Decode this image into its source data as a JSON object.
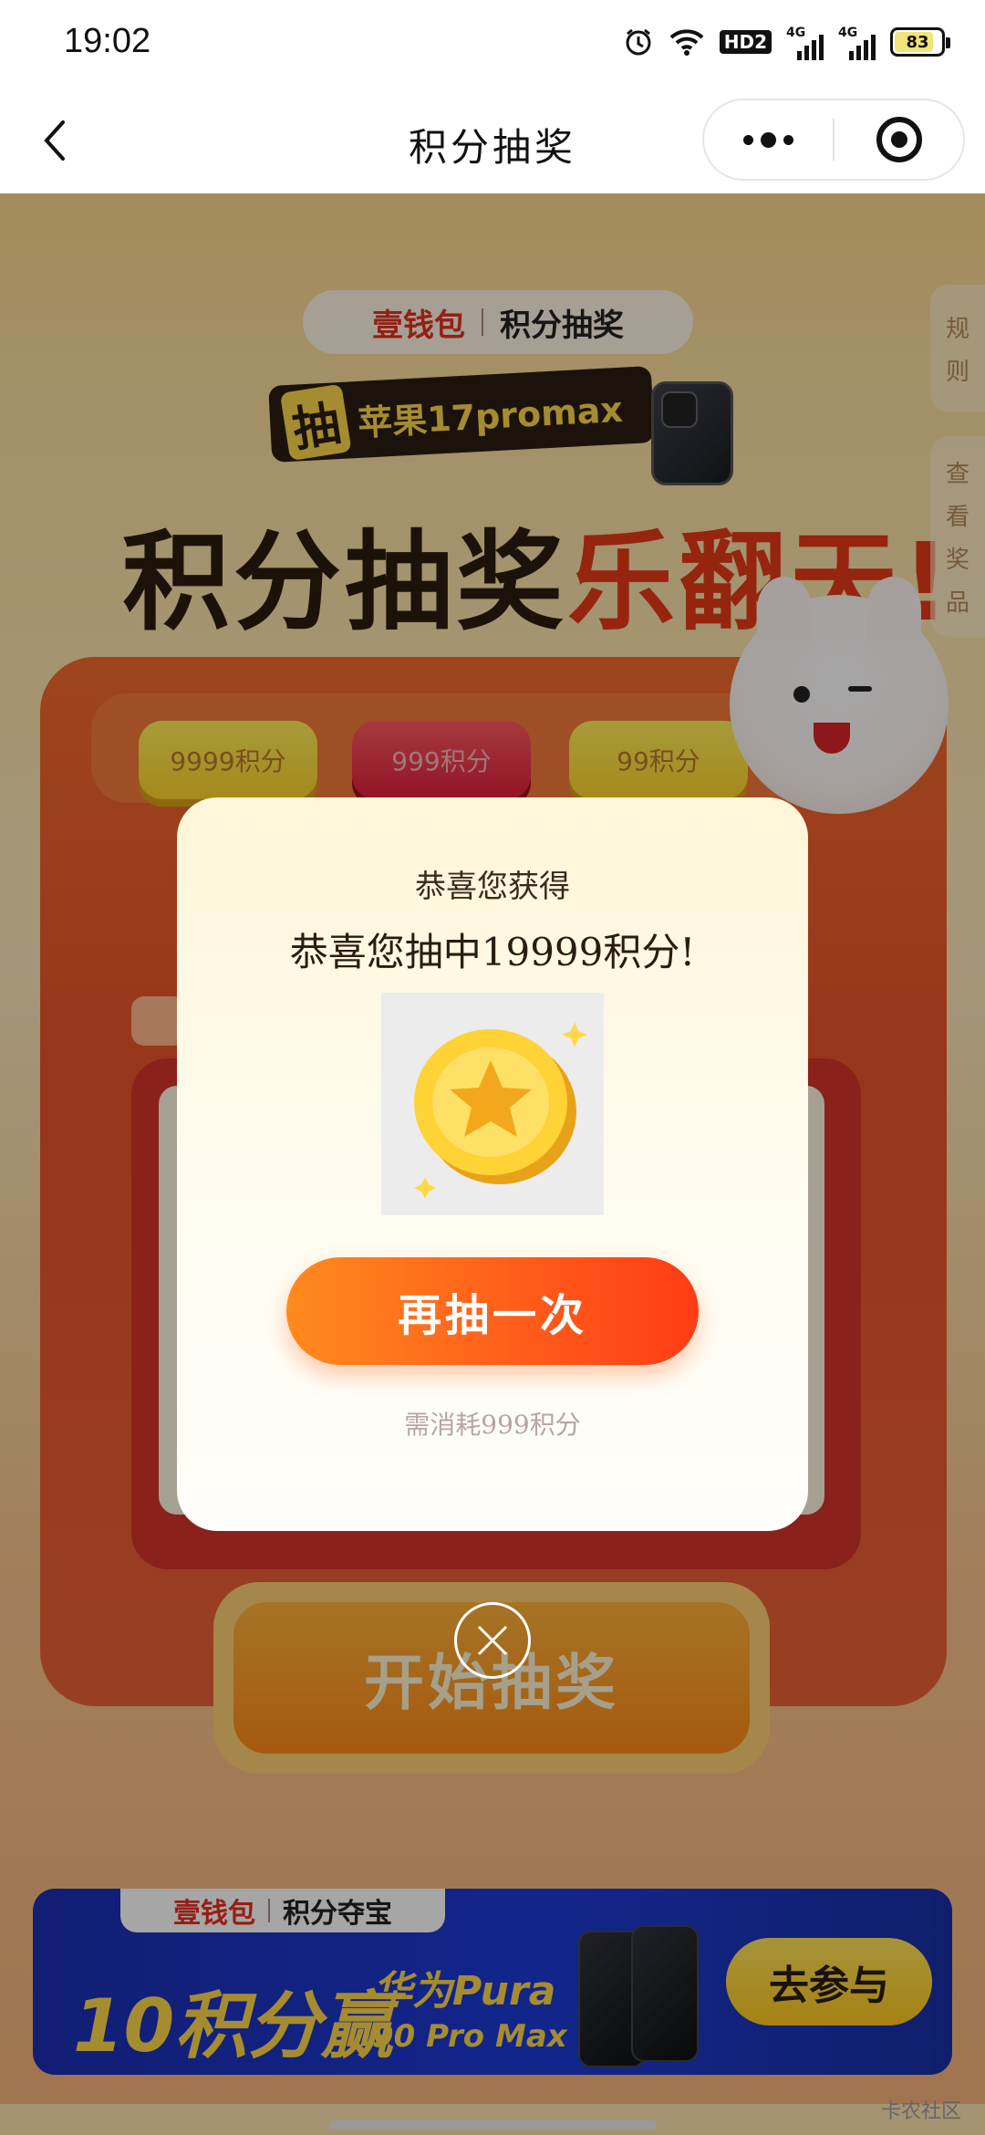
{
  "status_bar": {
    "time": "19:02",
    "hd": "HD2",
    "net1": "4G",
    "net2": "4G",
    "battery": "83"
  },
  "nav": {
    "title": "积分抽奖"
  },
  "page": {
    "brand_left": "壹钱包",
    "brand_right": "积分抽奖",
    "promo_chou": "抽",
    "promo_text": "苹果17promax",
    "headline_a": "积分抽奖",
    "headline_b": "乐翻天!",
    "side_rules": [
      "规",
      "则"
    ],
    "side_prizes": [
      "查",
      "看",
      "奖",
      "品"
    ],
    "tiers": [
      "9999积分",
      "999积分",
      "99积分"
    ],
    "start_label": "开始抽奖"
  },
  "banner": {
    "tag_left": "壹钱包",
    "tag_right": "积分夺宝",
    "headline": "10积分赢",
    "product_line1": "华为Pura",
    "product_line2": "90 Pro Max",
    "cta": "去参与"
  },
  "modal": {
    "title": "恭喜您获得",
    "message": "恭喜您抽中19999积分!",
    "button": "再抽一次",
    "cost_note": "需消耗999积分"
  },
  "watermark": "卡农社区",
  "colors": {
    "accent": "#ff5a1a",
    "coin": "#ffcc2a",
    "brand_red": "#e3301e"
  }
}
